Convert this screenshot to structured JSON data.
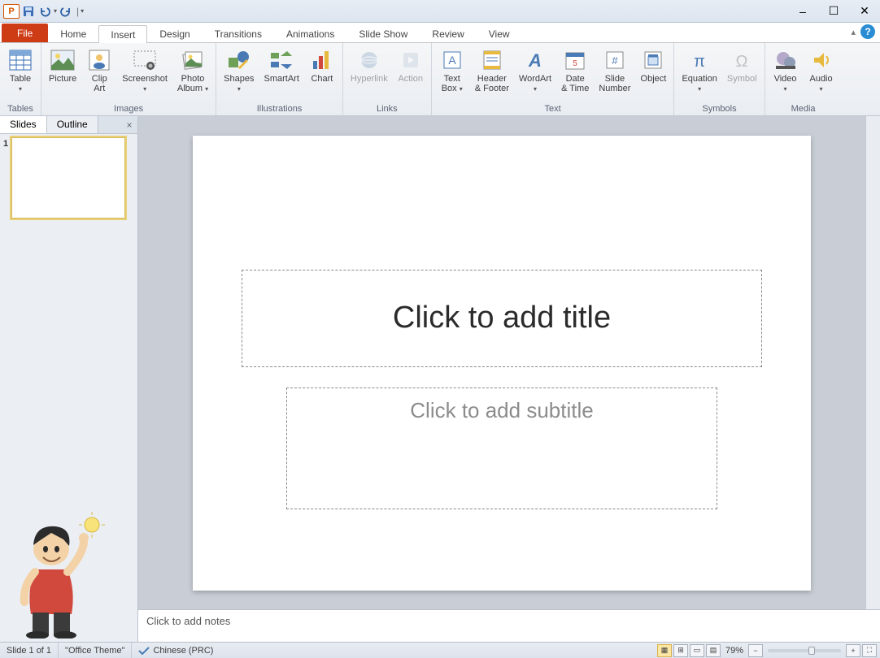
{
  "qat": {
    "app_letter": "P"
  },
  "window": {
    "minimize": "–",
    "maximize": "☐",
    "close": "✕"
  },
  "tabs": {
    "file": "File",
    "items": [
      "Home",
      "Insert",
      "Design",
      "Transitions",
      "Animations",
      "Slide Show",
      "Review",
      "View"
    ],
    "active": "Insert"
  },
  "ribbon": {
    "tables": {
      "label": "Tables",
      "table": "Table"
    },
    "images": {
      "label": "Images",
      "picture": "Picture",
      "clipart": "Clip\nArt",
      "screenshot": "Screenshot",
      "album": "Photo\nAlbum"
    },
    "illustrations": {
      "label": "Illustrations",
      "shapes": "Shapes",
      "smartart": "SmartArt",
      "chart": "Chart"
    },
    "links": {
      "label": "Links",
      "hyperlink": "Hyperlink",
      "action": "Action"
    },
    "text": {
      "label": "Text",
      "textbox": "Text\nBox",
      "headerfooter": "Header\n& Footer",
      "wordart": "WordArt",
      "datetime": "Date\n& Time",
      "slidenum": "Slide\nNumber",
      "object": "Object"
    },
    "symbols": {
      "label": "Symbols",
      "equation": "Equation",
      "symbol": "Symbol"
    },
    "media": {
      "label": "Media",
      "video": "Video",
      "audio": "Audio"
    }
  },
  "leftpanel": {
    "slides_tab": "Slides",
    "outline_tab": "Outline",
    "close": "×",
    "thumb_num": "1"
  },
  "slide": {
    "title_ph": "Click to add title",
    "subtitle_ph": "Click to add subtitle"
  },
  "notes": {
    "placeholder": "Click to add notes"
  },
  "status": {
    "slide_info": "Slide 1 of 1",
    "theme": "\"Office Theme\"",
    "language": "Chinese (PRC)",
    "zoom": "79%"
  }
}
